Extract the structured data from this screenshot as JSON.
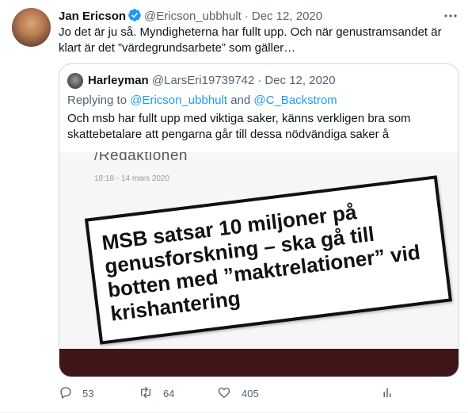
{
  "tweet": {
    "author_name": "Jan Ericson",
    "author_handle": "@Ericson_ubbhult",
    "separator": "·",
    "date": "Dec 12, 2020",
    "text": "Jo det är ju så. Myndigheterna har fullt upp. Och när genustramsandet är klart är det ”värdegrundsarbete” som gäller…"
  },
  "quote": {
    "author_name": "Harleyman",
    "author_handle": "@LarsEri19739742",
    "separator": "·",
    "date": "Dec 12, 2020",
    "replying_prefix": "Replying to",
    "reply_handle_1": "@Ericson_ubbhult",
    "reply_and": "and",
    "reply_handle_2": "@C_Backstrom",
    "text": "Och msb har fullt upp med viktiga saker, känns verkligen bra som skattebetalare att pengarna går till dessa nödvändiga saker å",
    "image": {
      "byline": "/Redaktionen",
      "timestamp": "18:18 - 14 mars 2020",
      "headline": "MSB satsar 10 miljoner på genusforskning – ska gå till botten med ”maktrelationer” vid krishantering"
    }
  },
  "actions": {
    "reply_count": "53",
    "retweet_count": "64",
    "like_count": "405"
  },
  "icons": {
    "verified": "verified-badge-icon",
    "more": "more-icon",
    "reply": "reply-icon",
    "retweet": "retweet-icon",
    "like": "heart-icon",
    "share": "analytics-icon"
  },
  "colors": {
    "accent": "#1d9bf0",
    "muted": "#536471",
    "border": "#cfd9de"
  }
}
